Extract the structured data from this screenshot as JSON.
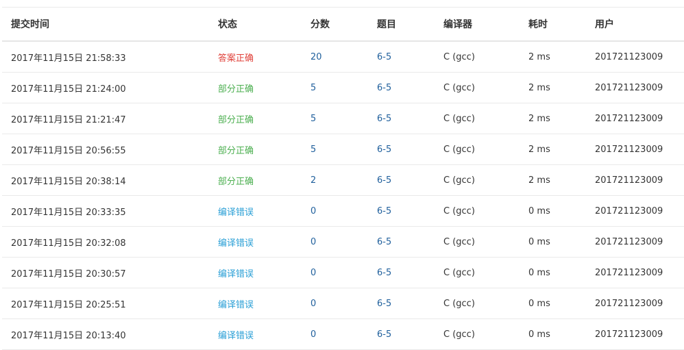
{
  "table": {
    "headers": {
      "submit_time": "提交时间",
      "status": "状态",
      "score": "分数",
      "problem": "题目",
      "compiler": "编译器",
      "time_used": "耗时",
      "user": "用户"
    },
    "rows": [
      {
        "submit_time": "2017年11月15日 21:58:33",
        "status": "答案正确",
        "status_type": "accepted",
        "score": "20",
        "problem": "6-5",
        "compiler": "C (gcc)",
        "time_used": "2 ms",
        "user": "201721123009"
      },
      {
        "submit_time": "2017年11月15日 21:24:00",
        "status": "部分正确",
        "status_type": "partial",
        "score": "5",
        "problem": "6-5",
        "compiler": "C (gcc)",
        "time_used": "2 ms",
        "user": "201721123009"
      },
      {
        "submit_time": "2017年11月15日 21:21:47",
        "status": "部分正确",
        "status_type": "partial",
        "score": "5",
        "problem": "6-5",
        "compiler": "C (gcc)",
        "time_used": "2 ms",
        "user": "201721123009"
      },
      {
        "submit_time": "2017年11月15日 20:56:55",
        "status": "部分正确",
        "status_type": "partial",
        "score": "5",
        "problem": "6-5",
        "compiler": "C (gcc)",
        "time_used": "2 ms",
        "user": "201721123009"
      },
      {
        "submit_time": "2017年11月15日 20:38:14",
        "status": "部分正确",
        "status_type": "partial",
        "score": "2",
        "problem": "6-5",
        "compiler": "C (gcc)",
        "time_used": "2 ms",
        "user": "201721123009"
      },
      {
        "submit_time": "2017年11月15日 20:33:35",
        "status": "编译错误",
        "status_type": "compile-error",
        "score": "0",
        "problem": "6-5",
        "compiler": "C (gcc)",
        "time_used": "0 ms",
        "user": "201721123009"
      },
      {
        "submit_time": "2017年11月15日 20:32:08",
        "status": "编译错误",
        "status_type": "compile-error",
        "score": "0",
        "problem": "6-5",
        "compiler": "C (gcc)",
        "time_used": "0 ms",
        "user": "201721123009"
      },
      {
        "submit_time": "2017年11月15日 20:30:57",
        "status": "编译错误",
        "status_type": "compile-error",
        "score": "0",
        "problem": "6-5",
        "compiler": "C (gcc)",
        "time_used": "0 ms",
        "user": "201721123009"
      },
      {
        "submit_time": "2017年11月15日 20:25:51",
        "status": "编译错误",
        "status_type": "compile-error",
        "score": "0",
        "problem": "6-5",
        "compiler": "C (gcc)",
        "time_used": "0 ms",
        "user": "201721123009"
      },
      {
        "submit_time": "2017年11月15日 20:13:40",
        "status": "编译错误",
        "status_type": "compile-error",
        "score": "0",
        "problem": "6-5",
        "compiler": "C (gcc)",
        "time_used": "0 ms",
        "user": "201721123009"
      }
    ]
  },
  "colors": {
    "accepted": "#e0413a",
    "partial": "#4caf50",
    "compile_error": "#2a9fd6",
    "link": "#1f5f9c"
  }
}
